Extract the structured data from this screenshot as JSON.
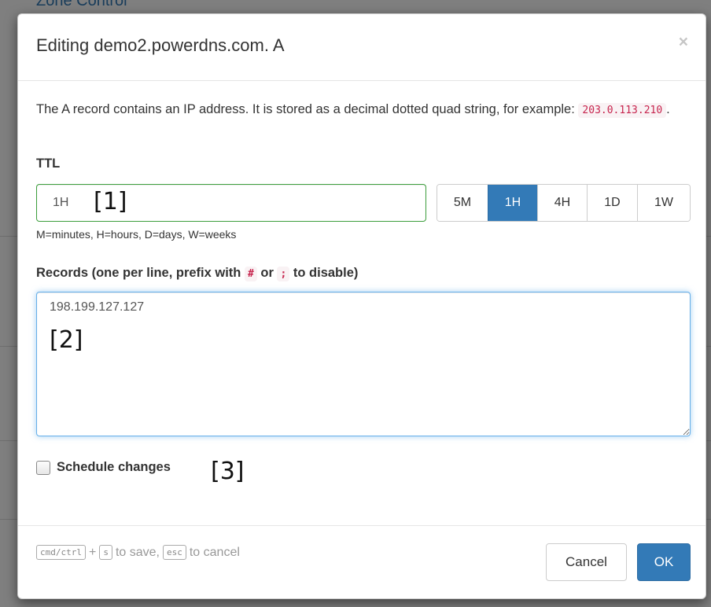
{
  "background": {
    "header_text": "Zone Control"
  },
  "modal": {
    "title": "Editing demo2.powerdns.com. A",
    "close_glyph": "×",
    "description_prefix": "The A record contains an IP address. It is stored as a decimal dotted quad string, for example: ",
    "description_example": "203.0.113.210",
    "description_suffix": "."
  },
  "ttl": {
    "label": "TTL",
    "value": "1H",
    "help": "M=minutes, H=hours, D=days, W=weeks",
    "presets": [
      "5M",
      "1H",
      "4H",
      "1D",
      "1W"
    ],
    "selected": "1H"
  },
  "records": {
    "label_prefix": "Records (one per line, prefix with ",
    "hash": "#",
    "or": " or ",
    "semicolon": ";",
    "label_suffix": " to disable)",
    "value": "198.199.127.127"
  },
  "schedule": {
    "label": "Schedule changes",
    "checked": false
  },
  "markers": {
    "m1": "[1]",
    "m2": "[2]",
    "m3": "[3]"
  },
  "footer": {
    "kbd_mod": "cmd/ctrl",
    "plus": "+",
    "kbd_save": "s",
    "save_text": "to save,",
    "kbd_esc": "esc",
    "cancel_text": "to cancel",
    "cancel_label": "Cancel",
    "ok_label": "OK"
  },
  "colors": {
    "primary": "#337ab7",
    "success_border": "#3c9e3c",
    "code_red": "#c7254e"
  }
}
